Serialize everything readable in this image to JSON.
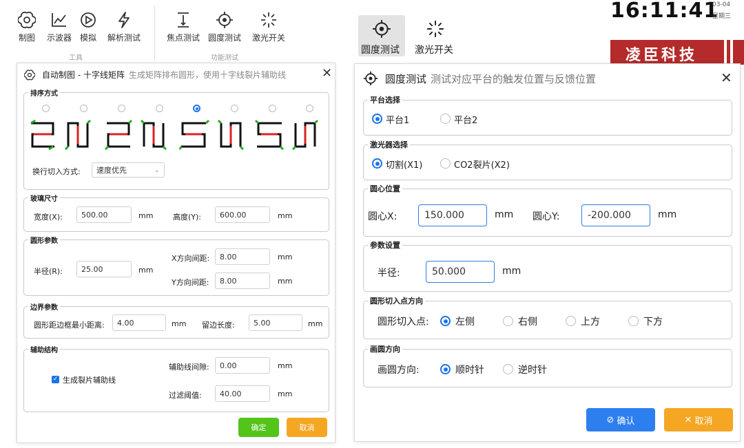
{
  "ribbon_left": {
    "tools": [
      {
        "label": "制图",
        "icon": "openai-logo-icon"
      },
      {
        "label": "示波器",
        "icon": "line-chart-icon"
      },
      {
        "label": "模拟",
        "icon": "play-circle-icon"
      },
      {
        "label": "解析测试",
        "icon": "lightning-icon"
      }
    ],
    "tools_caption": "工具",
    "functions": [
      {
        "label": "焦点测试",
        "icon": "focus-icon"
      },
      {
        "label": "圆度测试",
        "icon": "crosshair-icon"
      },
      {
        "label": "激光开关",
        "icon": "laser-icon"
      }
    ],
    "functions_caption": "功能测试"
  },
  "ribbon_right": {
    "items": [
      {
        "label": "圆度测试",
        "icon": "crosshair-icon"
      },
      {
        "label": "激光开关",
        "icon": "laser-icon"
      }
    ]
  },
  "clock": {
    "time": "16:11:41",
    "date": "03-04",
    "weekday": "星期三"
  },
  "brand": {
    "text": "凌臣科技",
    "color": "#b52a2a"
  },
  "dialog_left": {
    "title": "自动制图 - 十字线矩阵",
    "subtitle": "生成矩阵排布圆形，使用十字线裂片辅助线",
    "sort": {
      "legend": "排序方式",
      "selected_index": 4,
      "line_switch_label": "换行切入方式:",
      "line_switch_value": "速度优先"
    },
    "glass": {
      "legend": "玻璃尺寸",
      "width_label": "宽度(X):",
      "width_value": "500.00",
      "width_unit": "mm",
      "height_label": "高度(Y):",
      "height_value": "600.00",
      "height_unit": "mm"
    },
    "circle": {
      "legend": "圆形参数",
      "radius_label": "半径(R):",
      "radius_value": "25.00",
      "radius_unit": "mm",
      "x_spacing_label": "X方向间距:",
      "x_spacing_value": "8.00",
      "x_spacing_unit": "mm",
      "y_spacing_label": "Y方向间距:",
      "y_spacing_value": "8.00",
      "y_spacing_unit": "mm"
    },
    "boundary": {
      "legend": "边界参数",
      "min_dist_label": "圆形距边框最小距离:",
      "min_dist_value": "4.00",
      "min_dist_unit": "mm",
      "margin_label": "留边长度:",
      "margin_value": "5.00",
      "margin_unit": "mm"
    },
    "aux": {
      "legend": "辅助结构",
      "checkbox_label": "生成裂片辅助线",
      "checked": true,
      "gap_label": "辅助线间隙:",
      "gap_value": "0.00",
      "gap_unit": "mm",
      "filter_label": "过滤阈值:",
      "filter_value": "40.00",
      "filter_unit": "mm"
    },
    "ok_label": "确定",
    "cancel_label": "取消"
  },
  "dialog_right": {
    "title": "圆度测试",
    "subtitle": "测试对应平台的触发位置与反馈位置",
    "platform": {
      "legend": "平台选择",
      "options": [
        "平台1",
        "平台2"
      ],
      "selected": 0
    },
    "laser": {
      "legend": "激光器选择",
      "options": [
        "切割(X1)",
        "CO2裂片(X2)"
      ],
      "selected": 0
    },
    "center": {
      "legend": "圆心位置",
      "x_label": "圆心X:",
      "x_value": "150.000",
      "x_unit": "mm",
      "y_label": "圆心Y:",
      "y_value": "-200.000",
      "y_unit": "mm"
    },
    "params": {
      "legend": "参数设置",
      "radius_label": "半径:",
      "radius_value": "50.000",
      "radius_unit": "mm"
    },
    "entry": {
      "legend": "圆形切入点方向",
      "label": "圆形切入点:",
      "options": [
        "左侧",
        "右侧",
        "上方",
        "下方"
      ],
      "selected": 0
    },
    "direction": {
      "legend": "画圆方向",
      "label": "画圆方向:",
      "options": [
        "顺时针",
        "逆时针"
      ],
      "selected": 0
    },
    "confirm_label": "确认",
    "cancel_label": "取消"
  },
  "colors": {
    "primary": "#1a73e8",
    "confirm": "#2d7ff0",
    "cancel": "#f5a623",
    "ok_green": "#52c41a"
  }
}
